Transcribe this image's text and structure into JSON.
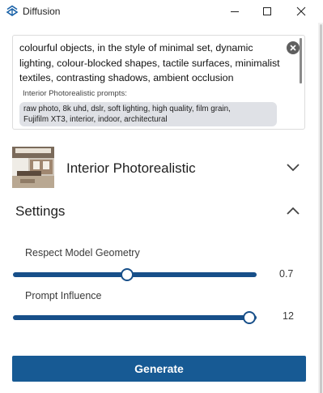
{
  "window": {
    "title": "Diffusion",
    "app_icon": "diffusion-logo-icon",
    "controls": [
      "minimize-icon",
      "maximize-icon",
      "close-icon"
    ]
  },
  "prompt": {
    "text": "colourful objects, in the style of minimal set, dynamic\nlighting, colour-blocked shapes, tactile surfaces, minimalist\ntextiles, contrasting shadows, ambient occlusion",
    "clear_icon": "clear-icon",
    "preset_caption": "Interior Photorealistic prompts:",
    "preset_prompt": "raw photo, 8k uhd, dslr, soft lighting, high quality, film grain,\nFujifilm XT3, interior, indoor, architectural"
  },
  "style": {
    "name": "Interior Photorealistic",
    "thumbnail": "interior-room-thumbnail",
    "chevron": "chevron-down-icon"
  },
  "settings": {
    "title": "Settings",
    "chevron": "chevron-up-icon",
    "sliders": [
      {
        "label": "Respect Model Geometry",
        "value": "0.7",
        "fraction": 0.47
      },
      {
        "label": "Prompt Influence",
        "value": "12",
        "fraction": 0.97
      }
    ]
  },
  "actions": {
    "generate_label": "Generate"
  },
  "colors": {
    "accent": "#175a94",
    "slider": "#174f89"
  }
}
